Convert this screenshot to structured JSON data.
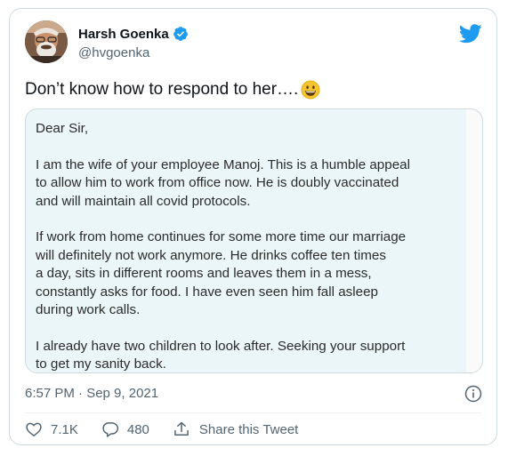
{
  "author": {
    "display_name": "Harsh Goenka",
    "handle": "@hvgoenka",
    "verified": true
  },
  "brand": {
    "logo_icon": "twitter-bird-icon",
    "accent_color": "#1d9bf0"
  },
  "tweet": {
    "text": "Don’t know how to respond to her….",
    "emoji_icon": "grinning-face-emoji"
  },
  "letter": {
    "salutation": "Dear Sir,",
    "paragraphs": [
      [
        "I am the wife of your employee Manoj. This is a humble appeal",
        "to allow him to work from office now. He is doubly vaccinated",
        "and will maintain all covid protocols."
      ],
      [
        "If work from home continues for some more time our marriage",
        "will definitely not work anymore. He drinks coffee ten times",
        "a day, sits in different rooms and leaves them in a mess,",
        "constantly asks for food. I have even seen him fall asleep",
        "during work calls."
      ],
      [
        "I already have two children to look after. Seeking your support",
        "to get my sanity back."
      ]
    ]
  },
  "meta": {
    "timestamp": "6:57 PM · Sep 9, 2021"
  },
  "actions": {
    "likes": "7.1K",
    "replies": "480",
    "share_label": "Share this Tweet"
  }
}
